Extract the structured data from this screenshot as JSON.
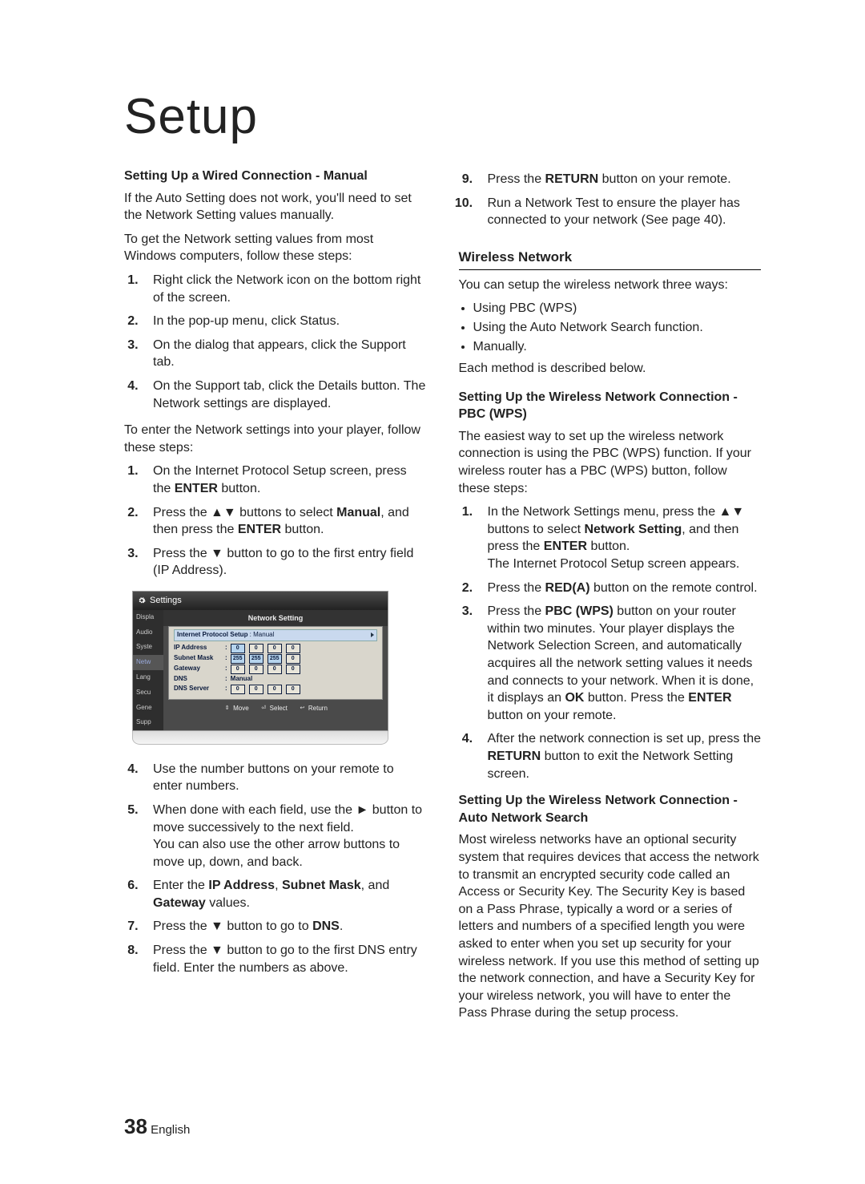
{
  "page_title": "Setup",
  "left_column": {
    "heading_manual": "Setting Up a Wired Connection - Manual",
    "intro_p1": "If the Auto Setting does not work, you'll need to set the Network Setting values manually.",
    "intro_p2": "To get the Network setting values from most Windows computers, follow these steps:",
    "steps_get": [
      "Right click the Network icon on the bottom right of the screen.",
      "In the pop-up menu, click Status.",
      "On the dialog that appears, click the Support tab.",
      "On the Support tab, click the Details button. The Network settings are displayed."
    ],
    "enter_intro": "To enter the Network settings into your player, follow these steps:",
    "steps_enter_first3": [
      {
        "pre": "On the Internet Protocol Setup screen, press the ",
        "b1": "ENTER",
        "post": " button."
      },
      {
        "pre": "Press the ▲▼ buttons to select ",
        "b1": "Manual",
        "mid": ", and then press the ",
        "b2": "ENTER",
        "post": " button."
      },
      {
        "pre": "Press the ▼ button to go to the first entry field (IP Address).",
        "b1": "",
        "post": ""
      }
    ],
    "steps_enter_rest": [
      {
        "n": "4",
        "text": "Use the number buttons on your remote to enter numbers."
      },
      {
        "n": "5",
        "pre": "When done with each field, use the ► button to move successively to the next field.",
        "post": " You can also use the other arrow buttons to move up, down, and back."
      },
      {
        "n": "6",
        "pre": "Enter the ",
        "b1": "IP Address",
        "mid1": ", ",
        "b2": "Subnet Mask",
        "mid2": ", and ",
        "b3": "Gateway",
        "post": " values."
      },
      {
        "n": "7",
        "pre": "Press the ▼ button to go to ",
        "b1": "DNS",
        "post": "."
      },
      {
        "n": "8",
        "text": "Press the ▼ button to go to the first DNS entry field. Enter the numbers as above."
      }
    ]
  },
  "right_column": {
    "steps_cont": [
      {
        "n": "9",
        "pre": "Press the ",
        "b1": "RETURN",
        "post": " button on your remote."
      },
      {
        "n": "10",
        "text": "Run a Network Test to ensure the player has connected to your network (See page 40)."
      }
    ],
    "wireless_heading": "Wireless Network",
    "wireless_intro": "You can setup the wireless network three ways:",
    "wireless_bullets": [
      "Using PBC (WPS)",
      "Using the Auto Network Search function.",
      "Manually."
    ],
    "wireless_outro": "Each method is described below.",
    "pbc_heading": "Setting Up the Wireless Network Connection - PBC (WPS)",
    "pbc_intro": "The easiest way to set up the wireless network connection is using the PBC (WPS) function. If your wireless router has a PBC (WPS) button, follow these steps:",
    "pbc_steps": [
      {
        "pre": "In the Network Settings menu, press the ▲▼ buttons to select ",
        "b1": "Network Setting",
        "mid": ", and then press the ",
        "b2": "ENTER",
        "post1": " button.",
        "post2": " The Internet Protocol Setup screen appears."
      },
      {
        "pre": "Press the ",
        "b1": "RED(A)",
        "post": " button on the remote control."
      },
      {
        "pre": "Press the ",
        "b1": "PBC (WPS)",
        "mid": " button on your router within two minutes. Your player displays the Network Selection Screen, and automatically acquires all the network setting values it needs and connects to your network. When it is done, it displays an ",
        "b2": "OK",
        "mid2": " button. Press the ",
        "b3": "ENTER",
        "post": " button on your remote."
      },
      {
        "pre": "After the network connection is set up, press the ",
        "b1": "RETURN",
        "post": " button to exit the Network Setting screen."
      }
    ],
    "auto_heading": "Setting Up the Wireless Network Connection - Auto Network Search",
    "auto_body": "Most wireless networks have an optional security system that requires devices that access the network to transmit an encrypted security code called an Access or Security Key. The Security Key is based on a Pass Phrase, typically a word or a series of letters and numbers of a specified length you were asked to enter when you set up security for your wireless network. If you use this method of setting up the network connection, and have a Security Key for your wireless network, you will have to enter the Pass Phrase during the setup process."
  },
  "settings_ui": {
    "bar_label": "Settings",
    "sidebar": [
      "Displa",
      "Audio",
      "Syste",
      "Netw",
      "Lang",
      "Secu",
      "Gene",
      "Supp"
    ],
    "panel_title": "Network Setting",
    "ips_label": "Internet Protocol Setup",
    "ips_value": "Manual",
    "rows": {
      "ip_label": "IP Address",
      "ip": [
        "0",
        "0",
        "0",
        "0"
      ],
      "subnet_label": "Subnet Mask",
      "subnet": [
        "255",
        "255",
        "255",
        "0"
      ],
      "gateway_label": "Gateway",
      "gateway": [
        "0",
        "0",
        "0",
        "0"
      ],
      "dns_label": "DNS",
      "dns_value": "Manual",
      "dnsserver_label": "DNS Server",
      "dnsserver": [
        "0",
        "0",
        "0",
        "0"
      ]
    },
    "footer": {
      "move": "Move",
      "select": "Select",
      "return": "Return"
    }
  },
  "footer": {
    "page_no": "38",
    "lang": "English"
  }
}
